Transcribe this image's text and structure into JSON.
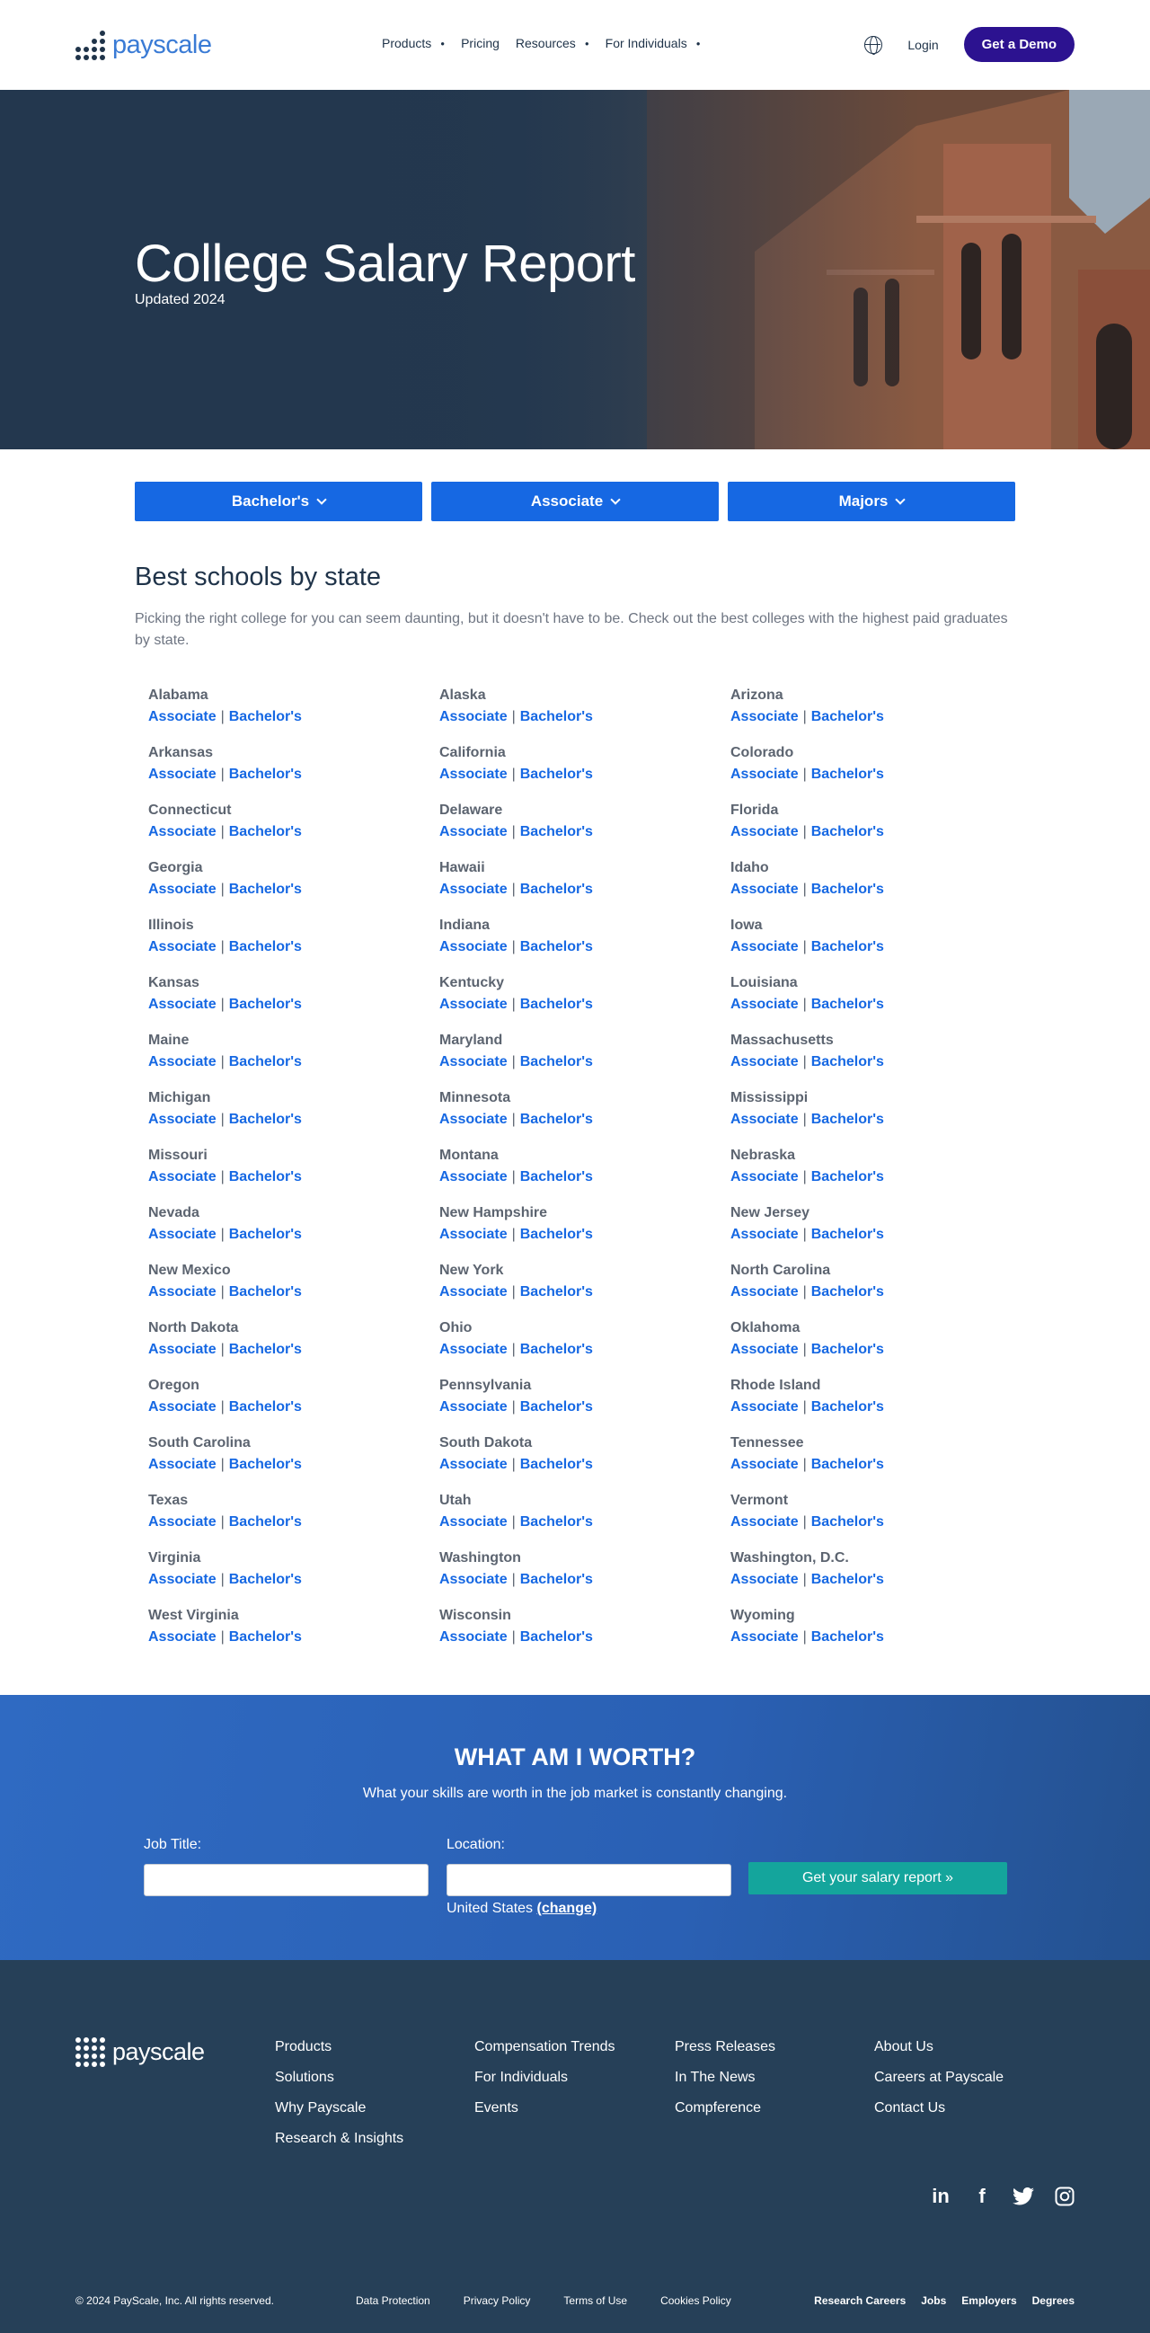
{
  "header": {
    "logo_text": "payscale",
    "nav": [
      "Products",
      "Pricing",
      "Resources",
      "For Individuals"
    ],
    "login": "Login",
    "demo": "Get a Demo"
  },
  "hero": {
    "title": "College Salary Report",
    "subtitle": "Updated 2024"
  },
  "tabs": [
    "Bachelor's",
    "Associate",
    "Majors"
  ],
  "schools": {
    "title": "Best schools by state",
    "description": "Picking the right college for you can seem daunting, but it doesn't have to be. Check out the best colleges with the highest paid graduates by state.",
    "associate_label": "Associate",
    "bachelor_label": "Bachelor's",
    "separator": "|",
    "states": [
      "Alabama",
      "Alaska",
      "Arizona",
      "Arkansas",
      "California",
      "Colorado",
      "Connecticut",
      "Delaware",
      "Florida",
      "Georgia",
      "Hawaii",
      "Idaho",
      "Illinois",
      "Indiana",
      "Iowa",
      "Kansas",
      "Kentucky",
      "Louisiana",
      "Maine",
      "Maryland",
      "Massachusetts",
      "Michigan",
      "Minnesota",
      "Mississippi",
      "Missouri",
      "Montana",
      "Nebraska",
      "Nevada",
      "New Hampshire",
      "New Jersey",
      "New Mexico",
      "New York",
      "North Carolina",
      "North Dakota",
      "Ohio",
      "Oklahoma",
      "Oregon",
      "Pennsylvania",
      "Rhode Island",
      "South Carolina",
      "South Dakota",
      "Tennessee",
      "Texas",
      "Utah",
      "Vermont",
      "Virginia",
      "Washington",
      "Washington, D.C.",
      "West Virginia",
      "Wisconsin",
      "Wyoming"
    ]
  },
  "worth": {
    "title": "WHAT AM I WORTH?",
    "subtitle": "What your skills are worth in the job market is constantly changing.",
    "job_label": "Job Title:",
    "location_label": "Location:",
    "country": "United States",
    "change": "(change)",
    "button": "Get your salary report »"
  },
  "footer": {
    "logo_text": "payscale",
    "col1": [
      "Products",
      "Solutions",
      "Why Payscale",
      "Research & Insights"
    ],
    "col2": [
      "Compensation Trends",
      "For Individuals",
      "Events"
    ],
    "col3": [
      "Press Releases",
      "In The News",
      "Compference"
    ],
    "col4": [
      "About Us",
      "Careers at Payscale",
      "Contact Us"
    ],
    "social": [
      "linkedin-icon",
      "facebook-icon",
      "twitter-icon",
      "instagram-icon"
    ],
    "copyright": "© 2024 PayScale, Inc. All rights reserved.",
    "legal": [
      "Data Protection",
      "Privacy Policy",
      "Terms of Use",
      "Cookies Policy"
    ],
    "right_links": [
      "Research Careers",
      "Jobs",
      "Employers",
      "Degrees"
    ]
  }
}
